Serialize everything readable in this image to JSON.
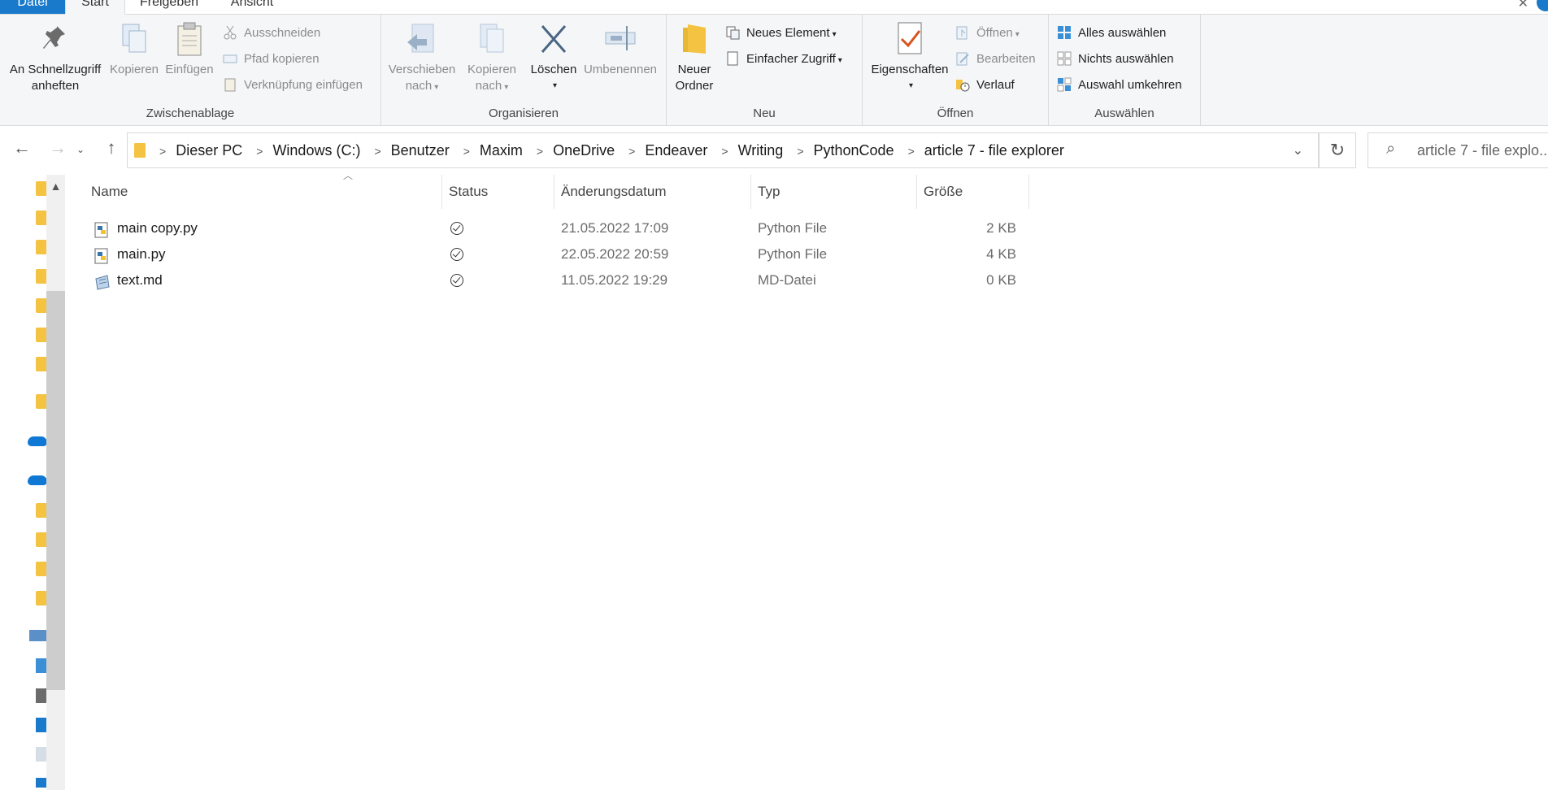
{
  "ribbon_tabs": {
    "file": "Datei",
    "start": "Start",
    "share": "Freigeben",
    "view": "Ansicht"
  },
  "ribbon": {
    "clipboard": {
      "pin_line1": "An Schnellzugriff",
      "pin_line2": "anheften",
      "copy": "Kopieren",
      "paste": "Einfügen",
      "cut": "Ausschneiden",
      "copy_path": "Pfad kopieren",
      "paste_shortcut": "Verknüpfung einfügen",
      "label": "Zwischenablage"
    },
    "organize": {
      "move_line1": "Verschieben",
      "move_line2": "nach",
      "copyto_line1": "Kopieren",
      "copyto_line2": "nach",
      "delete": "Löschen",
      "rename": "Umbenennen",
      "label": "Organisieren"
    },
    "new": {
      "folder_line1": "Neuer",
      "folder_line2": "Ordner",
      "new_item": "Neues Element",
      "easy_access": "Einfacher Zugriff",
      "label": "Neu"
    },
    "open": {
      "properties": "Eigenschaften",
      "open": "Öffnen",
      "edit": "Bearbeiten",
      "history": "Verlauf",
      "label": "Öffnen"
    },
    "select": {
      "select_all": "Alles auswählen",
      "select_none": "Nichts auswählen",
      "invert": "Auswahl umkehren",
      "label": "Auswählen"
    }
  },
  "address": {
    "crumbs": [
      "Dieser PC",
      "Windows (C:)",
      "Benutzer",
      "Maxim",
      "OneDrive",
      "Endeaver",
      "Writing",
      "PythonCode",
      "article 7 - file explorer"
    ]
  },
  "search": {
    "text": "article 7 - file explo..."
  },
  "columns": {
    "name": "Name",
    "status": "Status",
    "date": "Änderungsdatum",
    "type": "Typ",
    "size": "Größe"
  },
  "files": [
    {
      "name": "main copy.py",
      "date": "21.05.2022 17:09",
      "type": "Python File",
      "size": "2 KB",
      "icon": "python-file-icon"
    },
    {
      "name": "main.py",
      "date": "22.05.2022 20:59",
      "type": "Python File",
      "size": "4 KB",
      "icon": "python-file-icon"
    },
    {
      "name": "text.md",
      "date": "11.05.2022 19:29",
      "type": "MD-Datei",
      "size": "0 KB",
      "icon": "markdown-file-icon"
    }
  ],
  "colors": {
    "accent": "#1979ca",
    "ribbon_bg": "#f5f6f7",
    "folder": "#f5c342",
    "onedrive": "#0f78d4"
  }
}
